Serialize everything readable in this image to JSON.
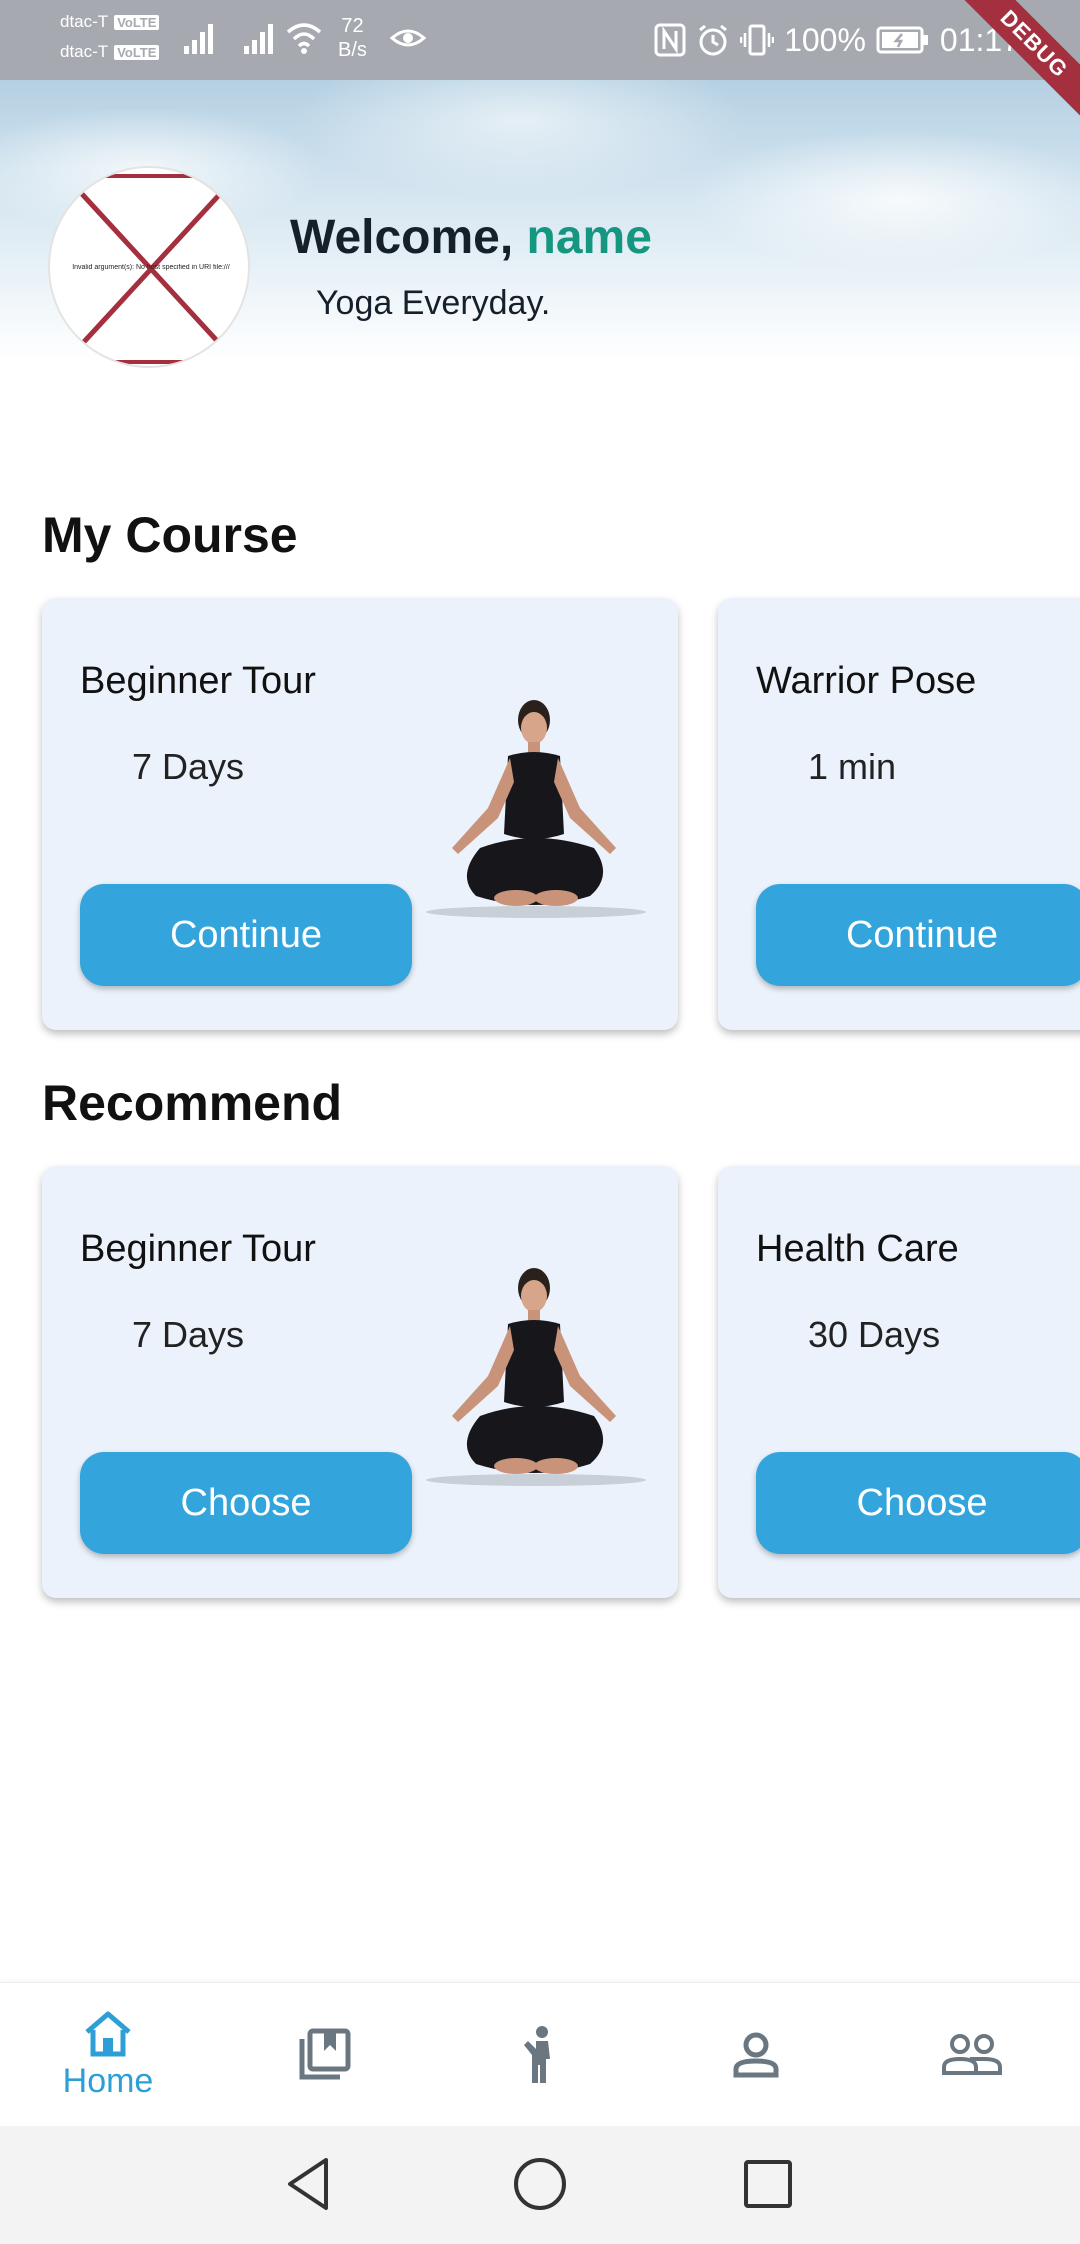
{
  "status_bar": {
    "carrier_1": "dtac-T",
    "carrier_2": "dtac-T",
    "volte_label": "VoLTE",
    "net_speed_value": "72",
    "net_speed_unit": "B/s",
    "battery": "100%",
    "time": "01:17",
    "icons": [
      "signal-icon",
      "wifi-icon",
      "eye-icon",
      "nfc-icon",
      "alarm-icon",
      "vibrate-icon",
      "battery-icon"
    ]
  },
  "debug_banner": "DEBUG",
  "header": {
    "avatar_error_text": "Invalid argument(s): No host specified in URI file:///",
    "welcome_prefix": "Welcome, ",
    "user_name": "name",
    "subtitle": "Yoga Everyday."
  },
  "my_course": {
    "title": "My Course",
    "cards": [
      {
        "title": "Beginner Tour",
        "duration": "7 Days",
        "button": "Continue"
      },
      {
        "title": "Warrior Pose",
        "duration": "1 min",
        "button": "Continue"
      }
    ]
  },
  "recommend": {
    "title": "Recommend",
    "cards": [
      {
        "title": "Beginner Tour",
        "duration": "7 Days",
        "button": "Choose"
      },
      {
        "title": "Health Care",
        "duration": "30 Days",
        "button": "Choose"
      }
    ]
  },
  "bottom_nav": {
    "items": [
      {
        "label": "Home",
        "icon": "home-icon",
        "active": true
      },
      {
        "label": "",
        "icon": "bookmark-book-icon",
        "active": false
      },
      {
        "label": "",
        "icon": "person-exercise-icon",
        "active": false
      },
      {
        "label": "",
        "icon": "person-icon",
        "active": false
      },
      {
        "label": "",
        "icon": "group-icon",
        "active": false
      }
    ]
  },
  "colors": {
    "accent": "#33a5dc",
    "name_highlight": "#149680",
    "card_bg": "#ebf2fb",
    "nav_active": "#2e9fd6",
    "nav_inactive": "#6b7780",
    "debug": "#a4303f"
  }
}
